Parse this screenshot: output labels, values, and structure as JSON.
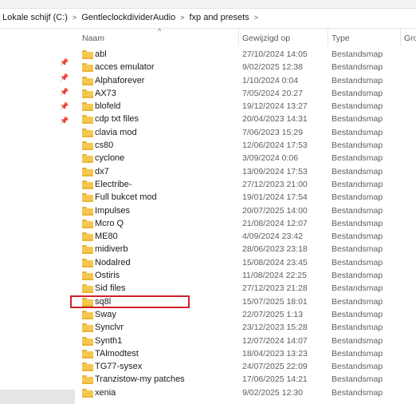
{
  "breadcrumb": [
    "Lokale schijf (C:)",
    "GentleclockdividerAudio",
    "fxp and presets"
  ],
  "breadcrumb_separator": ">",
  "columns": {
    "name": "Naam",
    "modified": "Gewijzigd op",
    "type": "Type",
    "size": "Gro"
  },
  "files": [
    {
      "name": "abl",
      "modified": "27/10/2024 14:05",
      "type": "Bestandsmap"
    },
    {
      "name": "acces emulator",
      "modified": "9/02/2025 12:38",
      "type": "Bestandsmap"
    },
    {
      "name": "Alphaforever",
      "modified": "1/10/2024 0:04",
      "type": "Bestandsmap"
    },
    {
      "name": "AX73",
      "modified": "7/05/2024 20:27",
      "type": "Bestandsmap"
    },
    {
      "name": "blofeld",
      "modified": "19/12/2024 13:27",
      "type": "Bestandsmap"
    },
    {
      "name": "cdp txt files",
      "modified": "20/04/2023 14:31",
      "type": "Bestandsmap"
    },
    {
      "name": "clavia mod",
      "modified": "7/06/2023 15:29",
      "type": "Bestandsmap"
    },
    {
      "name": "cs80",
      "modified": "12/06/2024 17:53",
      "type": "Bestandsmap"
    },
    {
      "name": "cyclone",
      "modified": "3/09/2024 0:06",
      "type": "Bestandsmap"
    },
    {
      "name": "dx7",
      "modified": "13/09/2024 17:53",
      "type": "Bestandsmap"
    },
    {
      "name": "Electribe-",
      "modified": "27/12/2023 21:00",
      "type": "Bestandsmap"
    },
    {
      "name": "Full bukcet mod",
      "modified": "19/01/2024 17:54",
      "type": "Bestandsmap"
    },
    {
      "name": "Impulses",
      "modified": "20/07/2025 14:00",
      "type": "Bestandsmap"
    },
    {
      "name": "Mcro Q",
      "modified": "21/08/2024 12:07",
      "type": "Bestandsmap"
    },
    {
      "name": "ME80",
      "modified": "4/09/2024 23:42",
      "type": "Bestandsmap"
    },
    {
      "name": "midiverb",
      "modified": "28/06/2023 23:18",
      "type": "Bestandsmap"
    },
    {
      "name": "Nodalred",
      "modified": "15/08/2024 23:45",
      "type": "Bestandsmap"
    },
    {
      "name": "Ostiris",
      "modified": "11/08/2024 22:25",
      "type": "Bestandsmap"
    },
    {
      "name": "Sid files",
      "modified": "27/12/2023 21:28",
      "type": "Bestandsmap"
    },
    {
      "name": "sq8l",
      "modified": "15/07/2025 18:01",
      "type": "Bestandsmap"
    },
    {
      "name": "Sway",
      "modified": "22/07/2025 1:13",
      "type": "Bestandsmap"
    },
    {
      "name": "Synclvr",
      "modified": "23/12/2023 15:28",
      "type": "Bestandsmap"
    },
    {
      "name": "Synth1",
      "modified": "12/07/2024 14:07",
      "type": "Bestandsmap"
    },
    {
      "name": "TAlmodtest",
      "modified": "18/04/2023 13:23",
      "type": "Bestandsmap"
    },
    {
      "name": "TG77-sysex",
      "modified": "24/07/2025 22:09",
      "type": "Bestandsmap"
    },
    {
      "name": "Tranzistow-my patches",
      "modified": "17/06/2025 14:21",
      "type": "Bestandsmap"
    },
    {
      "name": "xenia",
      "modified": "9/02/2025 12:30",
      "type": "Bestandsmap"
    }
  ],
  "colors": {
    "highlight_border": "#d0202a",
    "folder": "#f5c74f"
  }
}
